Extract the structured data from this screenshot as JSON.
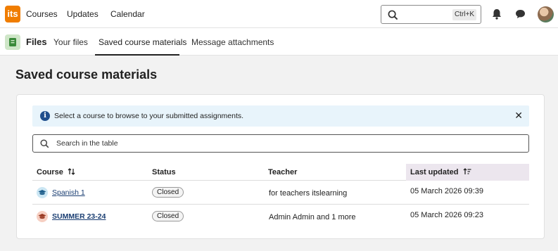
{
  "topbar": {
    "logo_text": "its",
    "nav": [
      "Courses",
      "Updates",
      "Calendar"
    ],
    "search_shortcut": "Ctrl+K"
  },
  "subbar": {
    "title": "Files",
    "tabs": [
      "Your files",
      "Saved course materials",
      "Message attachments"
    ],
    "active_tab": "Saved course materials"
  },
  "page": {
    "title": "Saved course materials"
  },
  "info": {
    "text": "Select a course to browse to your submitted assignments.",
    "close": "✕"
  },
  "table_search": {
    "placeholder": "Search in the table"
  },
  "table": {
    "headers": {
      "course": "Course",
      "status": "Status",
      "teacher": "Teacher",
      "last_updated": "Last updated"
    },
    "rows": [
      {
        "course": "Spanish 1",
        "status": "Closed",
        "teacher": "for teachers itslearning",
        "last_updated": "05 March 2026 09:39",
        "icon_bg": "#cbe6f3"
      },
      {
        "course": "SUMMER 23-24",
        "status": "Closed",
        "teacher": "Admin Admin and 1 more",
        "last_updated": "05 March 2026 09:23",
        "icon_bg": "#f6cfc2"
      }
    ]
  },
  "colors": {
    "brand": "#f07d00",
    "link": "#1a3e72",
    "info_bg": "#e8f4fb"
  }
}
